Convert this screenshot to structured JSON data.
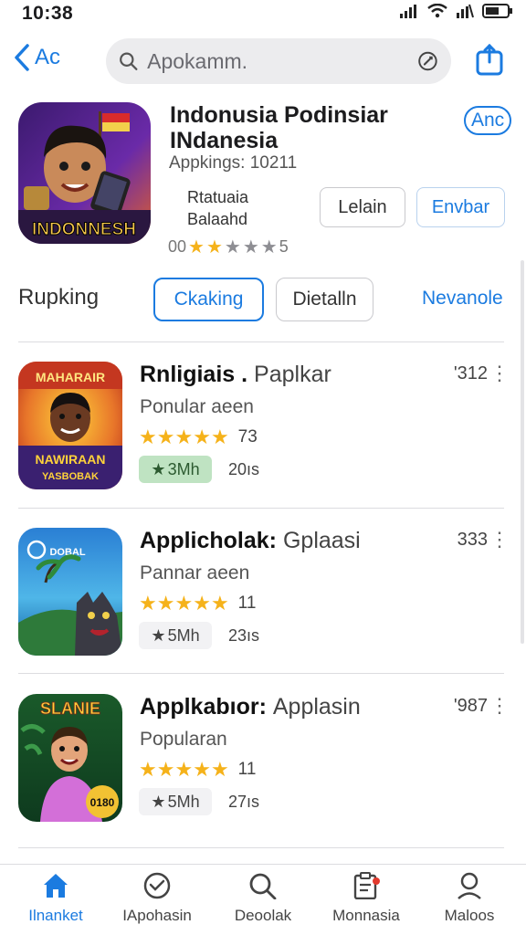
{
  "status_bar": {
    "time": "10:38"
  },
  "nav": {
    "back_label": "Ac",
    "search_placeholder": "Apokamm."
  },
  "app": {
    "title_line1": "Indonusia Podinsiar",
    "title_line2": "INdanesia",
    "publisher": "Appkings: 10211",
    "link_label": "Anc",
    "rating_label_line1": "Rtatuaia",
    "rating_label_line2": "Balaahd",
    "button_left": "Lelain",
    "button_right": "Envbar",
    "stars_prefix": "00",
    "stars_suffix": "5",
    "stars_full": 2,
    "stars_empty": 3,
    "icon_text": "INDONNESH"
  },
  "tabs": {
    "section_label": "Rupking",
    "active_tab": "Ckaking",
    "second_tab": "Dietalln",
    "link": "Nevanole"
  },
  "list_items": [
    {
      "title": "Rnligiais .",
      "title_sub": "Paplkar",
      "count": "'312",
      "subtitle": "Ponular aeen",
      "rating": "73",
      "badge": "3Mh",
      "badge_style": "green",
      "size": "20ıs",
      "icon_text_top": "MAHARAIR",
      "icon_text_bottom": "NAWIRAAN",
      "icon_text_bottom2": "YASBOBAK"
    },
    {
      "title": "Applicholak:",
      "title_sub": "Gplaasi",
      "count": "333",
      "subtitle": "Pannar aeen",
      "rating": "11",
      "badge": "5Mh",
      "badge_style": "plain",
      "size": "23ıs",
      "icon_text_top": "DOBAL",
      "icon_text_bottom": "",
      "icon_text_bottom2": ""
    },
    {
      "title": "Applkabıor:",
      "title_sub": "Applasin",
      "count": "'987",
      "subtitle": "Popularan",
      "rating": "11",
      "badge": "5Mh",
      "badge_style": "plain",
      "size": "27ıs",
      "icon_text_top": "SLANIE",
      "icon_text_bottom": "0180",
      "icon_text_bottom2": ""
    }
  ],
  "tabbar": [
    {
      "label": "Ilnanket",
      "icon": "home-icon"
    },
    {
      "label": "IApohasin",
      "icon": "heart-icon"
    },
    {
      "label": "Deoolak",
      "icon": "search-icon"
    },
    {
      "label": "Monnasia",
      "icon": "clipboard-icon"
    },
    {
      "label": "Maloos",
      "icon": "person-icon"
    }
  ],
  "colors": {
    "accent": "#1b7be0",
    "star": "#f5b21a",
    "badge_green": "#bfe3c2"
  }
}
